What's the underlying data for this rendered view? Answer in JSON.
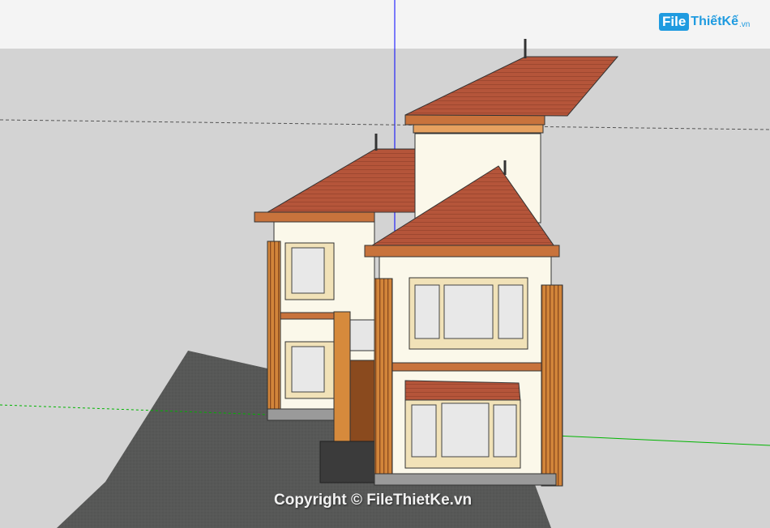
{
  "logo": {
    "file_text": "File",
    "thietke_text": "ThiếtKế",
    "tld_text": ".vn"
  },
  "watermark": {
    "text": "Copyright © FileThietKe.vn"
  },
  "colors": {
    "roof": "#b5553a",
    "wall": "#fbf8ea",
    "trim": "#c8733c",
    "pillar": "#d68a3c",
    "ground": "#555655",
    "axis_red": "#ff0000",
    "axis_green": "#00b400",
    "axis_blue": "#0000ff"
  }
}
